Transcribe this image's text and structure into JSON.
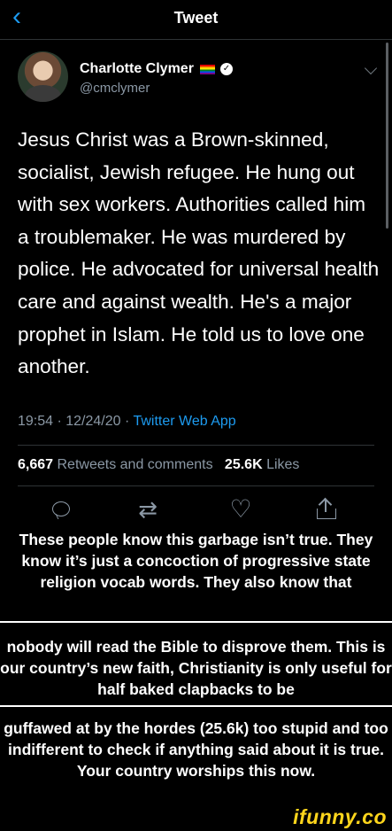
{
  "header": {
    "back_glyph": "‹",
    "title": "Tweet"
  },
  "author": {
    "name": "Charlotte Clymer",
    "handle": "@cmclymer"
  },
  "tweet": {
    "text": "Jesus Christ was a Brown-skinned, socialist, Jewish refugee. He hung out with sex workers. Authorities called him a troublemaker. He was murdered by police. He advocated for universal health care and against wealth. He's a major prophet in Islam. He told us to love one another.",
    "time": "19:54 · 12/24/20 · ",
    "source": "Twitter Web App"
  },
  "stats": {
    "retweets_count": "6,667",
    "retweets_label": "Retweets and comments",
    "likes_count": "25.6K",
    "likes_label": "Likes"
  },
  "actions": {
    "reply_icon": "reply-icon",
    "retweet_glyph": "⇄",
    "like_glyph": "♡",
    "share_icon": "share-icon"
  },
  "captions": {
    "block1": "These people know this garbage isn’t true. They know it’s just a concoction of progressive state religion vocab words. They also know that",
    "block2": "nobody will read the Bible to disprove them. This is our country’s new faith, Christianity is only useful for half baked clapbacks to be",
    "block3": "guffawed at by the hordes (25.6k) too stupid and too indifferent to check if anything said about it is true. Your country worships this now."
  },
  "watermark": "ifunny.co",
  "colors": {
    "accent": "#1d9bf0",
    "background": "#000000",
    "watermark": "#ffd61c"
  }
}
